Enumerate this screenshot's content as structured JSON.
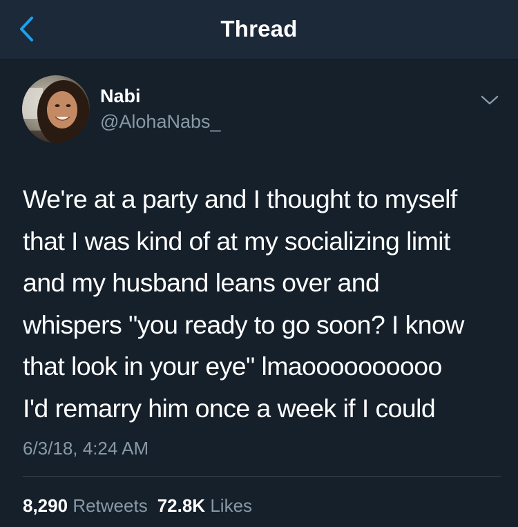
{
  "nav": {
    "title": "Thread"
  },
  "tweet": {
    "author_name": "Nabi",
    "author_handle": "@AlohaNabs_",
    "text": "We're at a party and I thought to myself\nthat I was kind of at my socializing limit\nand my husband leans over and\nwhispers \"you ready to go soon? I know\nthat look in your eye\" lmaoooooooooo\nI'd remarry him once a week if I could",
    "timestamp": "6/3/18, 4:24 AM",
    "retweets_count": "8,290",
    "retweets_label": "Retweets",
    "likes_count": "72.8K",
    "likes_label": "Likes"
  },
  "colors": {
    "background": "#15202b",
    "nav_background": "#1c2938",
    "accent": "#1da1f2",
    "secondary_text": "#8899a6"
  },
  "icons": [
    "back-chevron-icon",
    "chevron-down-icon"
  ]
}
